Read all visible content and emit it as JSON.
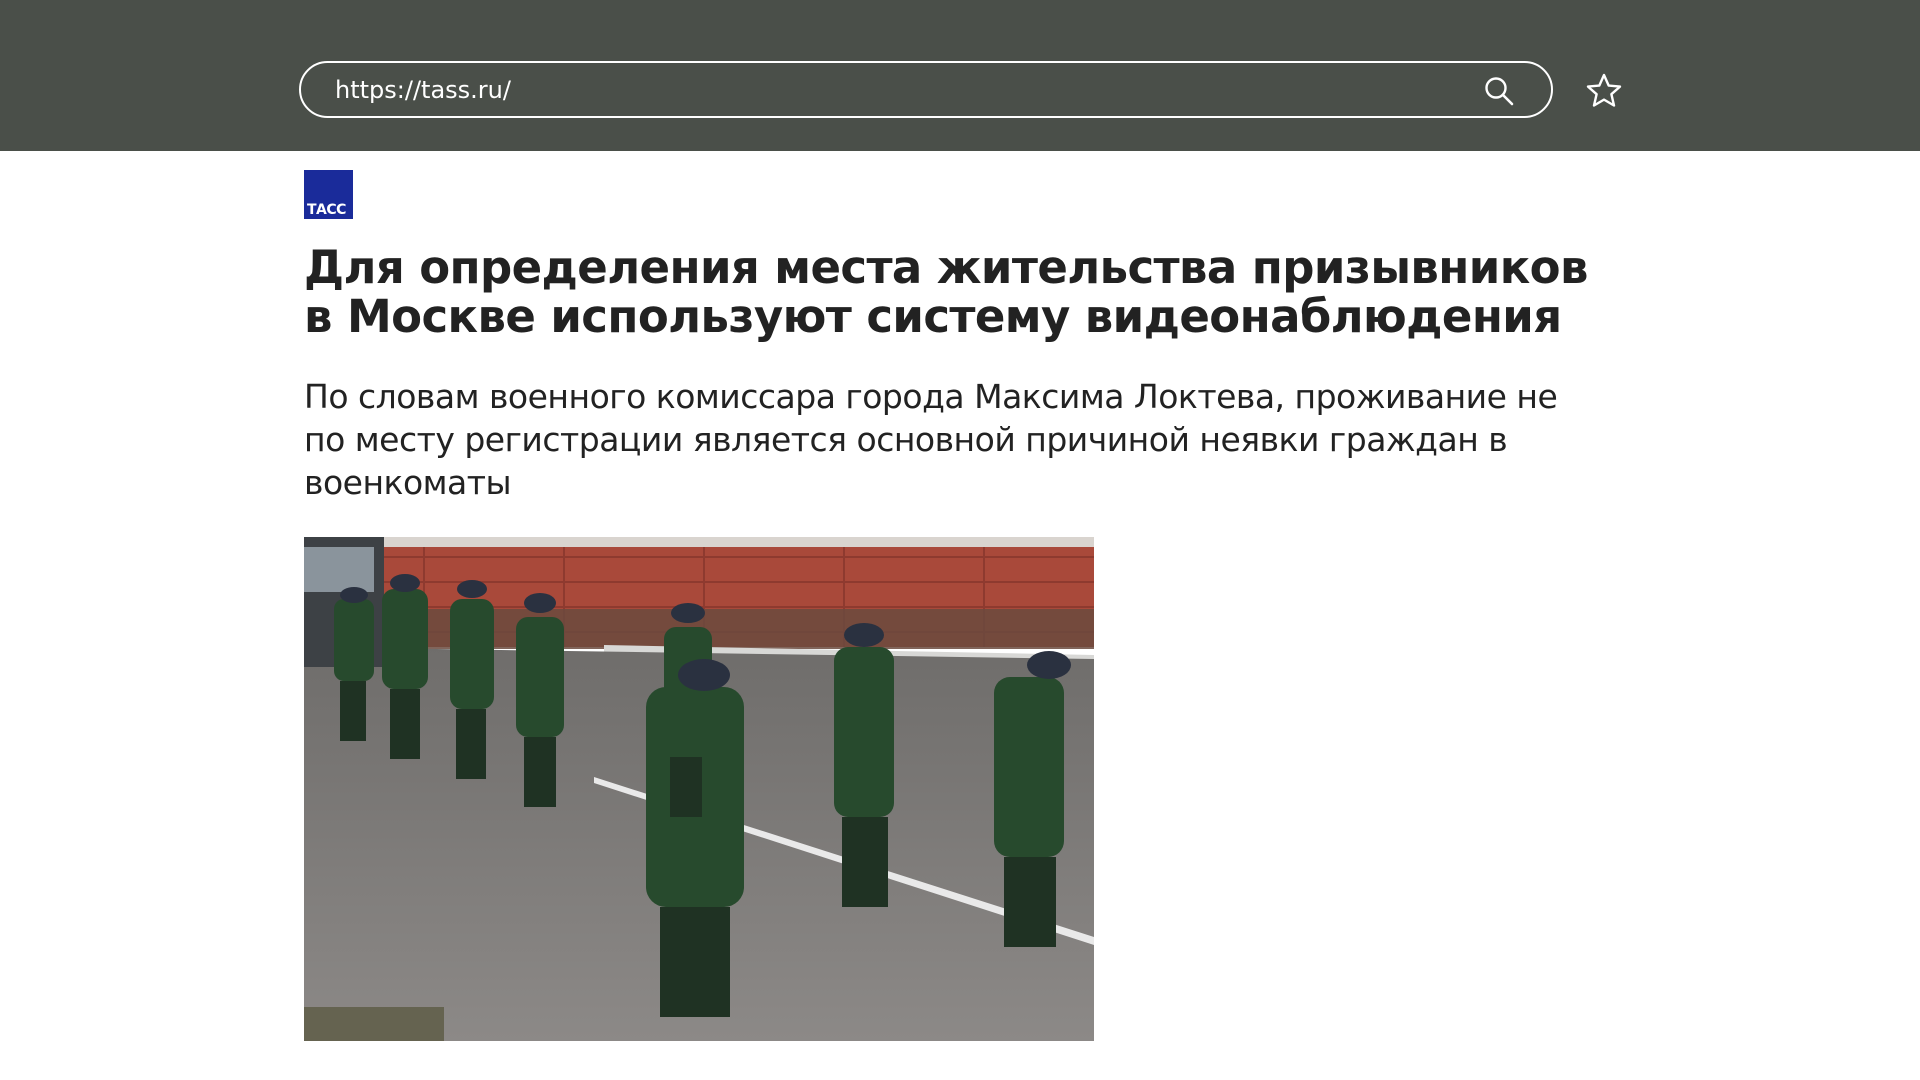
{
  "browser": {
    "url": "https://tass.ru/"
  },
  "article": {
    "logo_text": "ТАСС",
    "headline": "Для определения места жительства призывников в Москве используют систему видеонаблюдения",
    "lead": "По словам военного комиссара города Максима Локтева, проживание не по месту регистрации является основной причиной неявки граждан в военкоматы"
  },
  "colors": {
    "topbar": "#4a4f49",
    "logo": "#1a2b9a",
    "text": "#222222"
  },
  "icons": {
    "search": "search-icon",
    "bookmark": "star-icon"
  }
}
